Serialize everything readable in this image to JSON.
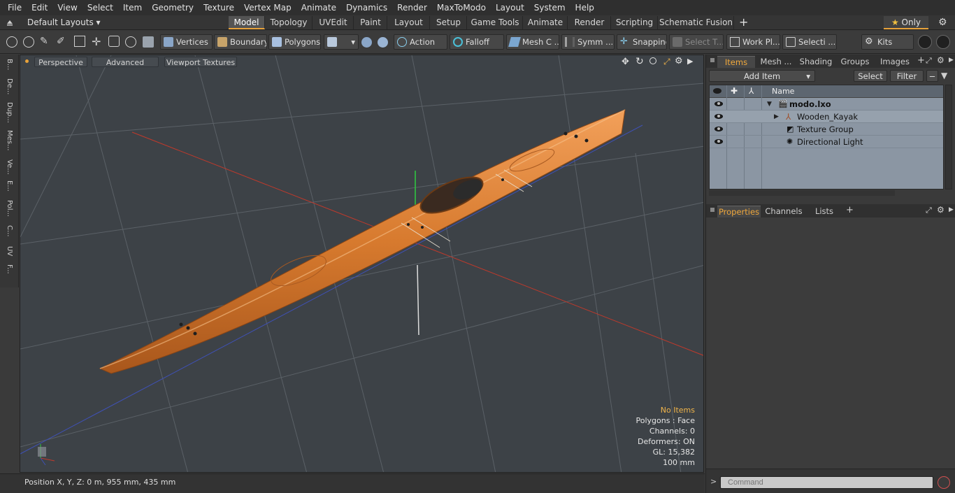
{
  "menu": [
    "File",
    "Edit",
    "View",
    "Select",
    "Item",
    "Geometry",
    "Texture",
    "Vertex Map",
    "Animate",
    "Dynamics",
    "Render",
    "MaxToModo",
    "Layout",
    "System",
    "Help"
  ],
  "layoutbar": {
    "preset": "Default Layouts",
    "tabs": [
      "Model",
      "Topology",
      "UVEdit",
      "Paint",
      "Layout",
      "Setup",
      "Game Tools",
      "Animate",
      "Render",
      "Scripting",
      "Schematic Fusion"
    ],
    "active_tab": "Model",
    "only_label": "Only"
  },
  "toolbar": {
    "vertices": "Vertices",
    "boundary": "Boundary",
    "polygons": "Polygons",
    "action": "Action",
    "falloff": "Falloff",
    "mesh": "Mesh C ...",
    "symmetry": "Symm ...",
    "snapping": "Snapping",
    "select_t": "Select T...",
    "work_plane": "Work Pl...",
    "selection": "Selecti ...",
    "kits": "Kits"
  },
  "leftstrip": [
    "B...",
    "De...",
    "Dup...",
    "Mes...",
    "Ve...",
    "E...",
    "Pol...",
    "C...",
    "UV",
    "F..."
  ],
  "viewport": {
    "perspective": "Perspective",
    "advanced": "Advanced",
    "viewport_textures": "Viewport Textures",
    "stats": {
      "no_items": "No Items",
      "polygons": "Polygons : Face",
      "channels": "Channels: 0",
      "deformers": "Deformers: ON",
      "gl": "GL: 15,382",
      "scale": "100 mm"
    }
  },
  "status": "Position X, Y, Z:   0 m, 955 mm, 435 mm",
  "items_panel": {
    "tabs": [
      "Items",
      "Mesh ...",
      "Shading",
      "Groups",
      "Images"
    ],
    "active_tab": "Items",
    "add_item": "Add Item",
    "select": "Select",
    "filter": "Filter",
    "name_header": "Name",
    "rows": [
      {
        "label": "modo.lxo",
        "indent": 0,
        "bold": true
      },
      {
        "label": "Wooden_Kayak",
        "indent": 1,
        "bold": false
      },
      {
        "label": "Texture Group",
        "indent": 1,
        "bold": false
      },
      {
        "label": "Directional Light",
        "indent": 1,
        "bold": false
      }
    ]
  },
  "properties_panel": {
    "tabs": [
      "Properties",
      "Channels",
      "Lists"
    ],
    "active_tab": "Properties"
  },
  "command": {
    "placeholder": "Command"
  },
  "colors": {
    "accent": "#e8a23a",
    "viewport_bg": "#3d4247",
    "item_list_bg": "#8b96a3"
  }
}
